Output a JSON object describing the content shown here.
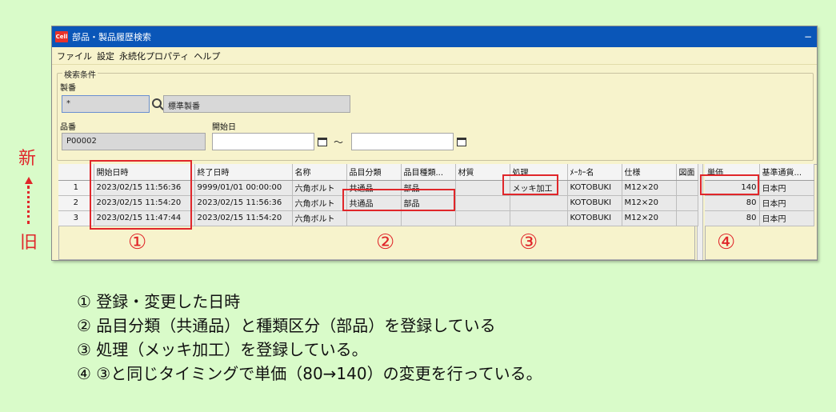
{
  "window": {
    "app_icon": "Cell",
    "title": "部品・製品履歴検索",
    "title_right": "−"
  },
  "menu": [
    "ファイル",
    "設定",
    "永続化プロパティ",
    "ヘルプ"
  ],
  "search": {
    "group_title": "検索条件",
    "seiban_label": "製番",
    "seiban_value": "*",
    "seiban_name": "標準製番",
    "hinban_label": "品番",
    "hinban_value": "P00002",
    "start_label": "開始日",
    "start_from": "",
    "start_to": "",
    "tilde": "～"
  },
  "grid": {
    "columns": [
      "",
      "開始日時",
      "終了日時",
      "名称",
      "品目分類",
      "品目種類...",
      "材質",
      "処理",
      "ﾒｰｶｰ名",
      "仕様",
      "図面"
    ],
    "rows": [
      [
        "1",
        "2023/02/15 11:56:36",
        "9999/01/01 00:00:00",
        "六角ボルト",
        "共通品",
        "部品",
        "",
        "メッキ加工",
        "KOTOBUKI",
        "M12×20",
        ""
      ],
      [
        "2",
        "2023/02/15 11:54:20",
        "2023/02/15 11:56:36",
        "六角ボルト",
        "共通品",
        "部品",
        "",
        "",
        "KOTOBUKI",
        "M12×20",
        ""
      ],
      [
        "3",
        "2023/02/15 11:47:44",
        "2023/02/15 11:54:20",
        "六角ボルト",
        "",
        "",
        "",
        "",
        "KOTOBUKI",
        "M12×20",
        ""
      ]
    ]
  },
  "price_grid": {
    "columns": [
      "単価",
      "基準通貨..."
    ],
    "rows": [
      [
        "140",
        "日本円"
      ],
      [
        "80",
        "日本円"
      ],
      [
        "80",
        "日本円"
      ]
    ]
  },
  "annotations": {
    "new": "新",
    "old": "旧",
    "markers": [
      "①",
      "②",
      "③",
      "④"
    ],
    "notes": [
      "① 登録・変更した日時",
      "② 品目分類（共通品）と種類区分（部品）を登録している",
      "③ 処理（メッキ加工）を登録している。",
      "④ ③と同じタイミングで単価（80→140）の変更を行っている。"
    ],
    "highlight_color": "#e0262a"
  }
}
